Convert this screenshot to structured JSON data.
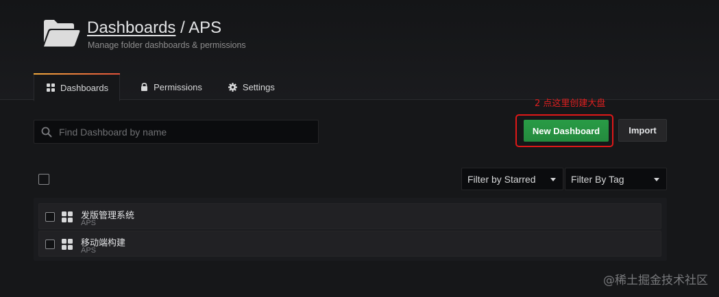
{
  "header": {
    "title_link": "Dashboards",
    "title_separator": " / ",
    "title_folder": "APS",
    "subtitle": "Manage folder dashboards & permissions",
    "icon": "folder-open-icon"
  },
  "tabs": [
    {
      "label": "Dashboards",
      "icon": "apps-icon",
      "active": true
    },
    {
      "label": "Permissions",
      "icon": "lock-icon",
      "active": false
    },
    {
      "label": "Settings",
      "icon": "cog-icon",
      "active": false
    }
  ],
  "search": {
    "placeholder": "Find Dashboard by name",
    "value": ""
  },
  "annotation": "2 点这里创建大盘",
  "actions": {
    "new_dashboard": "New Dashboard",
    "import": "Import"
  },
  "filters": {
    "starred": "Filter by Starred",
    "tag": "Filter By Tag"
  },
  "dashboards": [
    {
      "title": "发版管理系统",
      "folder": "APS"
    },
    {
      "title": "移动端构建",
      "folder": "APS"
    }
  ],
  "watermark": "@稀土掘金技术社区",
  "colors": {
    "accent_green": "#299c46",
    "tab_gradient_start": "#f2a93d",
    "tab_gradient_end": "#e4523a",
    "annotation_red": "#e02020"
  }
}
